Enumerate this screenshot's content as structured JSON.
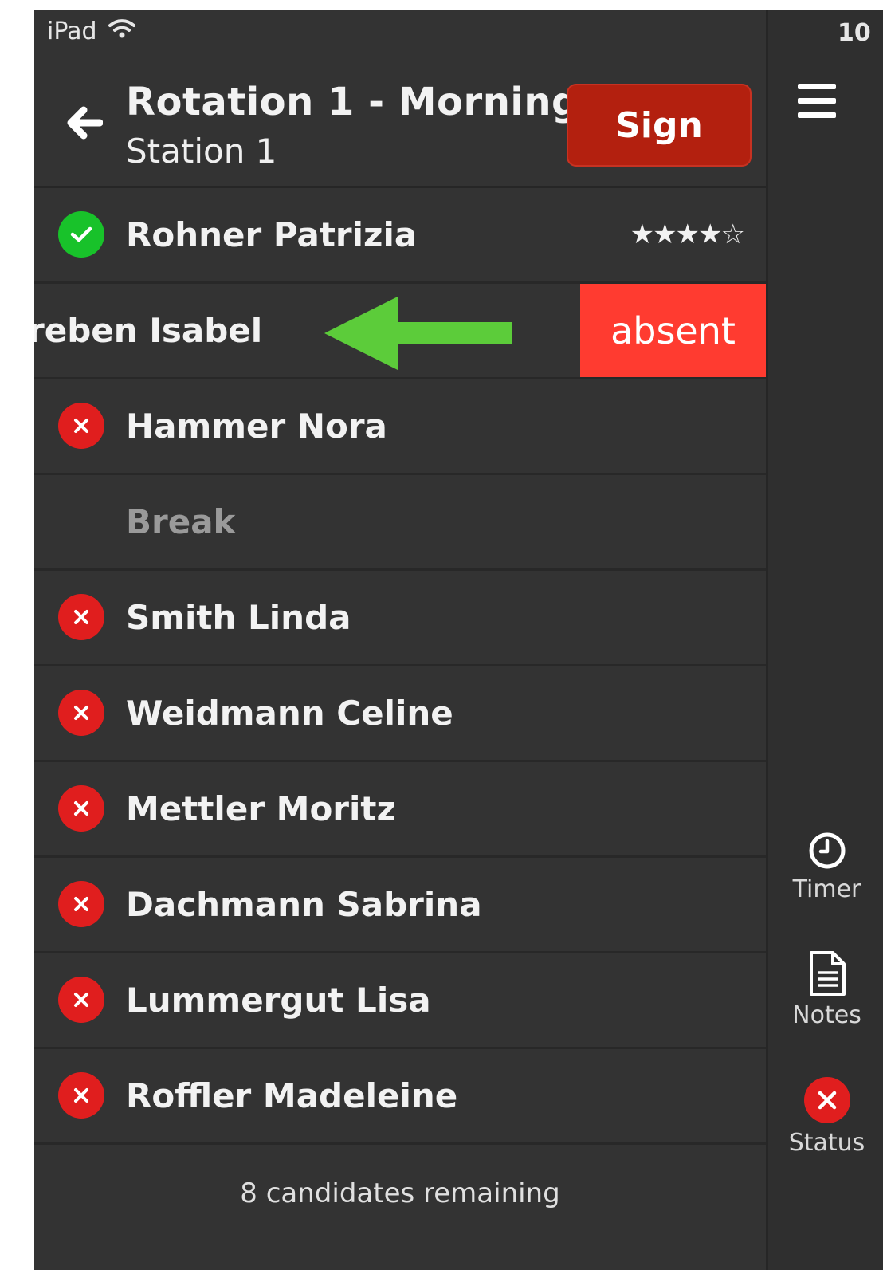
{
  "status_bar": {
    "device": "iPad",
    "time": "10"
  },
  "header": {
    "title": "Rotation 1 - Morning",
    "subtitle": "Station 1",
    "sign_label": "Sign"
  },
  "candidates": [
    {
      "name": "Rohner Patrizia",
      "status": "ok",
      "rating": "★★★★☆"
    },
    {
      "name": "reben Isabel",
      "swipe_action": "absent"
    },
    {
      "name": "Hammer Nora",
      "status": "missing"
    },
    {
      "name": "Break",
      "type": "break"
    },
    {
      "name": "Smith Linda",
      "status": "missing"
    },
    {
      "name": "Weidmann Celine",
      "status": "missing"
    },
    {
      "name": "Mettler Moritz",
      "status": "missing"
    },
    {
      "name": "Dachmann Sabrina",
      "status": "missing"
    },
    {
      "name": "Lummergut Lisa",
      "status": "missing"
    },
    {
      "name": "Roffler Madeleine",
      "status": "missing"
    }
  ],
  "footer": {
    "remaining": "8 candidates remaining"
  },
  "sidebar": {
    "timer_label": "Timer",
    "notes_label": "Notes",
    "status_label": "Status"
  },
  "colors": {
    "background": "#333333",
    "sign_button": "#b3200f",
    "absent_button": "#ff3b30",
    "ok_badge": "#18c22a",
    "missing_badge": "#e01e1e",
    "arrow": "#5ccc3a"
  },
  "icons": [
    "wifi-icon",
    "back-arrow-icon",
    "check-icon",
    "x-icon",
    "menu-icon",
    "timer-icon",
    "notes-icon",
    "status-x-icon",
    "swipe-left-arrow-icon"
  ]
}
